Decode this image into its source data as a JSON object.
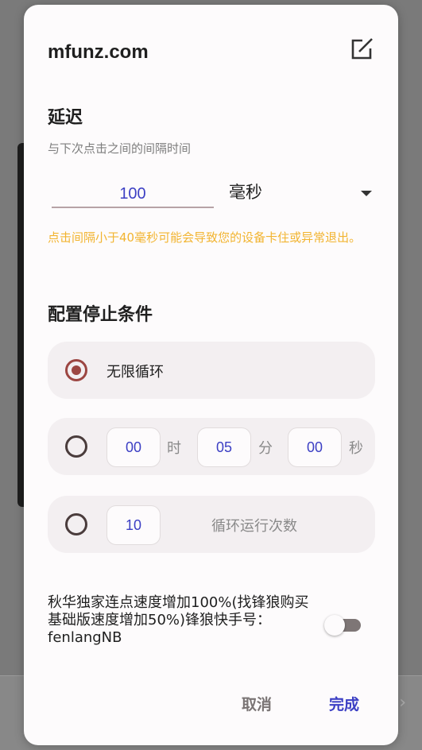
{
  "dialog": {
    "title": "mfunz.com",
    "icons": {
      "edit": "edit-icon",
      "dropdown": "dropdown-icon"
    }
  },
  "delay": {
    "section_title": "延迟",
    "subtitle": "与下次点击之间的间隔时间",
    "value": "100",
    "unit_selected": "毫秒",
    "warning": "点击间隔小于40毫秒可能会导致您的设备卡住或异常退出。"
  },
  "stop_conditions": {
    "section_title": "配置停止条件",
    "infinite_label": "无限循环",
    "timer": {
      "hours": "00",
      "hours_unit": "时",
      "minutes": "05",
      "minutes_unit": "分",
      "seconds": "00",
      "seconds_unit": "秒"
    },
    "loop": {
      "count": "10",
      "label": "循环运行次数"
    }
  },
  "promo": {
    "text": "秋华独家连点速度增加100%(找锋狼购买基础版速度增加50%)锋狼快手号：fenlangNB",
    "toggle_on": false
  },
  "actions": {
    "cancel": "取消",
    "done": "完成"
  },
  "colors": {
    "accent": "#3c3fc4",
    "warning": "#f2b430",
    "radio_selected": "#9c4642"
  }
}
